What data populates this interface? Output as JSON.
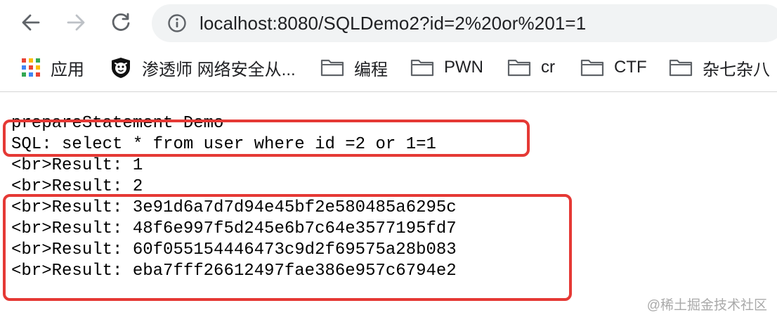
{
  "browser": {
    "url": "localhost:8080/SQLDemo2?id=2%20or%201=1",
    "icons": {
      "back": "arrow-left-icon",
      "forward": "arrow-right-icon",
      "reload": "reload-icon",
      "site_info": "info-icon"
    }
  },
  "bookmarks": [
    {
      "label": "应用",
      "icon": "apps-grid-icon"
    },
    {
      "label": "渗透师 网络安全从...",
      "icon": "shield-logo-icon"
    },
    {
      "label": "编程",
      "icon": "folder-icon"
    },
    {
      "label": "PWN",
      "icon": "folder-icon"
    },
    {
      "label": "cr",
      "icon": "folder-icon"
    },
    {
      "label": "CTF",
      "icon": "folder-icon"
    },
    {
      "label": "杂七杂八",
      "icon": "folder-icon"
    }
  ],
  "page": {
    "lines": [
      "prepareStatement Demo",
      "SQL: select * from user where id =2 or 1=1",
      "<br>Result: 1",
      "<br>Result: 2",
      "<br>Result: 3e91d6a7d7d94e45bf2e580485a6295c",
      "<br>Result: 48f6e997f5d245e6b7c64e3577195fd7",
      "<br>Result: 60f055154446473c9d2f69575a28b083",
      "<br>Result: eba7fff26612497fae386e957c6794e2"
    ]
  },
  "annotation_color": "#e53935",
  "watermark": "@稀土掘金技术社区"
}
